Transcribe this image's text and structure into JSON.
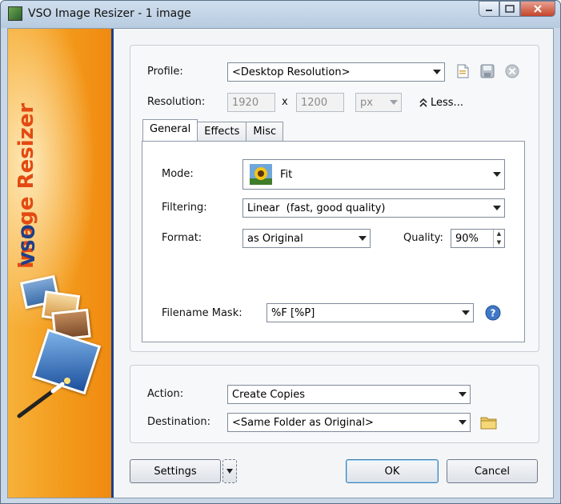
{
  "window": {
    "title": "VSO Image Resizer - 1 image"
  },
  "banner": {
    "title": "Image Resizer",
    "logo": "VSO"
  },
  "profile": {
    "label": "Profile:",
    "value": "<Desktop Resolution>",
    "icons": [
      "new-document-icon",
      "save-icon",
      "delete-icon"
    ]
  },
  "resolution": {
    "label": "Resolution:",
    "width": "1920",
    "separator": "x",
    "height": "1200",
    "unit": "px",
    "less_label": "Less..."
  },
  "tabs": [
    "General",
    "Effects",
    "Misc"
  ],
  "general": {
    "mode_label": "Mode:",
    "mode_value": "Fit",
    "filtering_label": "Filtering:",
    "filtering_value": "Linear  (fast, good quality)",
    "format_label": "Format:",
    "format_value": "as Original",
    "quality_label": "Quality:",
    "quality_value": "90%",
    "filename_mask_label": "Filename Mask:",
    "filename_mask_value": "%F [%P]"
  },
  "output": {
    "action_label": "Action:",
    "action_value": "Create Copies",
    "destination_label": "Destination:",
    "destination_value": "<Same Folder as Original>"
  },
  "buttons": {
    "settings": "Settings",
    "ok": "OK",
    "cancel": "Cancel"
  },
  "colors": {
    "banner_orange": "#f39a1b",
    "banner_title": "#e24a12",
    "accent_blue": "#1e3f8a"
  }
}
